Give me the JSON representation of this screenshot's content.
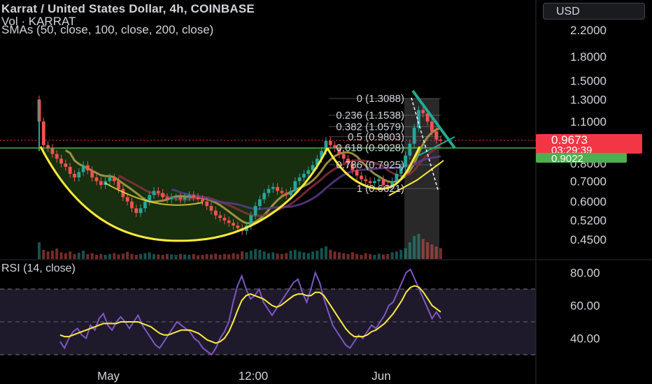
{
  "header": {
    "title": "Karrat / United States Dollar, 4h, COINBASE",
    "vol_label": "Vol · KARRAT",
    "sma_label": "SMAs (50, close, 100, close, 200, close)",
    "rsi_label": "RSI (14, close)",
    "currency_button": "USD"
  },
  "colors": {
    "background": "#000000",
    "up": "#26a69a",
    "down": "#ef5350",
    "price_line": "#4caf50",
    "current_price": "#f23645",
    "fib_support": "#22ab94",
    "rsi": "#7e57c2",
    "rsi_ma": "#ffeb3b",
    "pattern": "#ffeb3b",
    "sma50": "#b3a24a",
    "sma100": "#8a2f3a",
    "sma200": "#5b3a8a",
    "triangle": "#22ab94"
  },
  "chart_data": [
    {
      "type": "candlestick",
      "title": "Karrat / United States Dollar, 4h, COINBASE",
      "y_scale": "log",
      "y_ticks": [
        "2.2000",
        "1.8000",
        "1.5000",
        "1.3000",
        "1.1000",
        "0.8000",
        "0.7000",
        "0.6000",
        "0.5200",
        "0.4500"
      ],
      "y_tick_values": [
        2.2,
        1.8,
        1.5,
        1.3,
        1.1,
        0.8,
        0.7,
        0.6,
        0.52,
        0.45
      ],
      "x_ticks": [
        "May",
        "12:00",
        "Jun"
      ],
      "current_price": {
        "value": "0.9673",
        "countdown": "03:29:39"
      },
      "support_price": "0.9022",
      "fib_levels": [
        {
          "label": "0 (1.3088)",
          "value": 1.3088
        },
        {
          "label": "0.236 (1.1538)",
          "value": 1.1538
        },
        {
          "label": "0.382 (1.0579)",
          "value": 1.0579
        },
        {
          "label": "0.5 (0.9803)",
          "value": 0.9803
        },
        {
          "label": "0.618 (0.9028)",
          "value": 0.9028
        },
        {
          "label": "0.786 (0.7925)",
          "value": 0.7925
        },
        {
          "label": "1 (0.6621)",
          "value": 0.6621
        }
      ],
      "closes": [
        1.1,
        0.92,
        0.9,
        0.86,
        0.83,
        0.8,
        0.78,
        0.74,
        0.72,
        0.75,
        0.79,
        0.76,
        0.72,
        0.7,
        0.68,
        0.7,
        0.72,
        0.7,
        0.66,
        0.62,
        0.6,
        0.57,
        0.55,
        0.57,
        0.6,
        0.63,
        0.65,
        0.64,
        0.62,
        0.61,
        0.62,
        0.62,
        0.61,
        0.62,
        0.63,
        0.62,
        0.61,
        0.6,
        0.58,
        0.56,
        0.54,
        0.53,
        0.52,
        0.51,
        0.5,
        0.49,
        0.48,
        0.5,
        0.54,
        0.58,
        0.61,
        0.64,
        0.66,
        0.67,
        0.65,
        0.64,
        0.63,
        0.65,
        0.7,
        0.72,
        0.74,
        0.76,
        0.79,
        0.83,
        0.88,
        0.95,
        0.92,
        0.9,
        0.86,
        0.83,
        0.8,
        0.76,
        0.73,
        0.71,
        0.7,
        0.69,
        0.7,
        0.71,
        0.68,
        0.67,
        0.7,
        0.74,
        0.78,
        0.85,
        0.93,
        1.05,
        1.2,
        1.17,
        1.1,
        1.02,
        0.96,
        0.95
      ],
      "volumes": [
        40,
        22,
        18,
        20,
        25,
        16,
        14,
        18,
        12,
        15,
        20,
        12,
        14,
        10,
        12,
        10,
        12,
        14,
        11,
        13,
        17,
        12,
        10,
        12,
        14,
        16,
        12,
        11,
        10,
        12,
        11,
        10,
        12,
        11,
        10,
        12,
        9,
        10,
        12,
        11,
        13,
        10,
        12,
        11,
        14,
        12,
        18,
        16,
        20,
        24,
        22,
        18,
        14,
        16,
        13,
        12,
        14,
        20,
        22,
        18,
        16,
        14,
        18,
        20,
        26,
        30,
        22,
        18,
        16,
        14,
        12,
        16,
        12,
        10,
        14,
        12,
        10,
        13,
        11,
        12,
        16,
        18,
        22,
        26,
        40,
        55,
        60,
        48,
        40,
        35,
        30,
        26
      ]
    },
    {
      "type": "line",
      "title": "RSI (14, close)",
      "y_ticks": [
        "80.00",
        "60.00",
        "40.00"
      ],
      "y_tick_values": [
        80,
        60,
        40
      ],
      "band_lines": [
        70,
        50,
        30
      ],
      "x_ticks": [
        "May",
        "12:00",
        "Jun"
      ],
      "series": [
        {
          "values": [
            38,
            34,
            40,
            44,
            46,
            42,
            40,
            48,
            45,
            52,
            55,
            48,
            45,
            50,
            53,
            50,
            46,
            50,
            54,
            48,
            44,
            40,
            36,
            34,
            38,
            42,
            46,
            50,
            48,
            46,
            44,
            40,
            38,
            34,
            32,
            30,
            34,
            40,
            44,
            50,
            62,
            72,
            78,
            70,
            64,
            66,
            70,
            62,
            58,
            54,
            58,
            62,
            66,
            70,
            74,
            76,
            68,
            62,
            70,
            80,
            74,
            64,
            56,
            48,
            44,
            40,
            36,
            34,
            38,
            42,
            40,
            44,
            48,
            46,
            50,
            54,
            60,
            62,
            68,
            74,
            80,
            82,
            76,
            70,
            64,
            58,
            52,
            56,
            52
          ]
        },
        {
          "values": [
            42,
            41,
            41,
            42,
            43,
            44,
            45,
            46,
            47,
            48,
            49,
            49,
            49,
            49,
            50,
            50,
            50,
            50,
            50,
            49,
            48,
            47,
            45,
            43,
            42,
            42,
            43,
            44,
            45,
            45,
            45,
            44,
            43,
            41,
            39,
            38,
            37,
            38,
            40,
            44,
            50,
            57,
            63,
            66,
            67,
            66,
            65,
            64,
            62,
            60,
            59,
            60,
            62,
            64,
            66,
            67,
            67,
            66,
            66,
            68,
            68,
            66,
            62,
            58,
            54,
            50,
            46,
            43,
            41,
            41,
            41,
            42,
            44,
            45,
            47,
            49,
            52,
            55,
            59,
            63,
            68,
            71,
            72,
            71,
            68,
            64,
            60,
            58,
            56
          ]
        }
      ]
    }
  ]
}
